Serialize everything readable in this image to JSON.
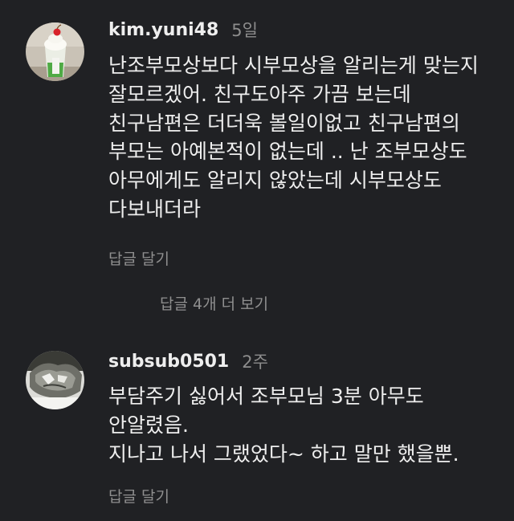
{
  "comments": [
    {
      "avatar_icon": "drink-photo-avatar",
      "username": "kim.yuni48",
      "timestamp": "5일",
      "lines": [
        "난조부모상보다 시부모상을 알리는게 맞는지",
        "잘모르겠어. 친구도아주 가끔 보는데",
        "친구남편은 더더욱 볼일이없고 친구남편의",
        "부모는 아예본적이 없는데 .. 난 조부모상도",
        "아무에게도 알리지 않았는데 시부모상도",
        "다보내더라"
      ],
      "reply_label": "답글 달기",
      "view_replies_label": "답글 4개 더 보기"
    },
    {
      "avatar_icon": "sculpture-photo-avatar",
      "username": "subsub0501",
      "timestamp": "2주",
      "lines": [
        "부담주기 싫어서 조부모님 3분 아무도",
        "안알렸음.",
        "지나고 나서 그랬었다~ 하고 말만 했을뿐."
      ],
      "reply_label": "답글 달기"
    }
  ],
  "colors": {
    "background": "#202124",
    "primary_text": "#eeeeee",
    "secondary_text": "#8f8f8f"
  }
}
